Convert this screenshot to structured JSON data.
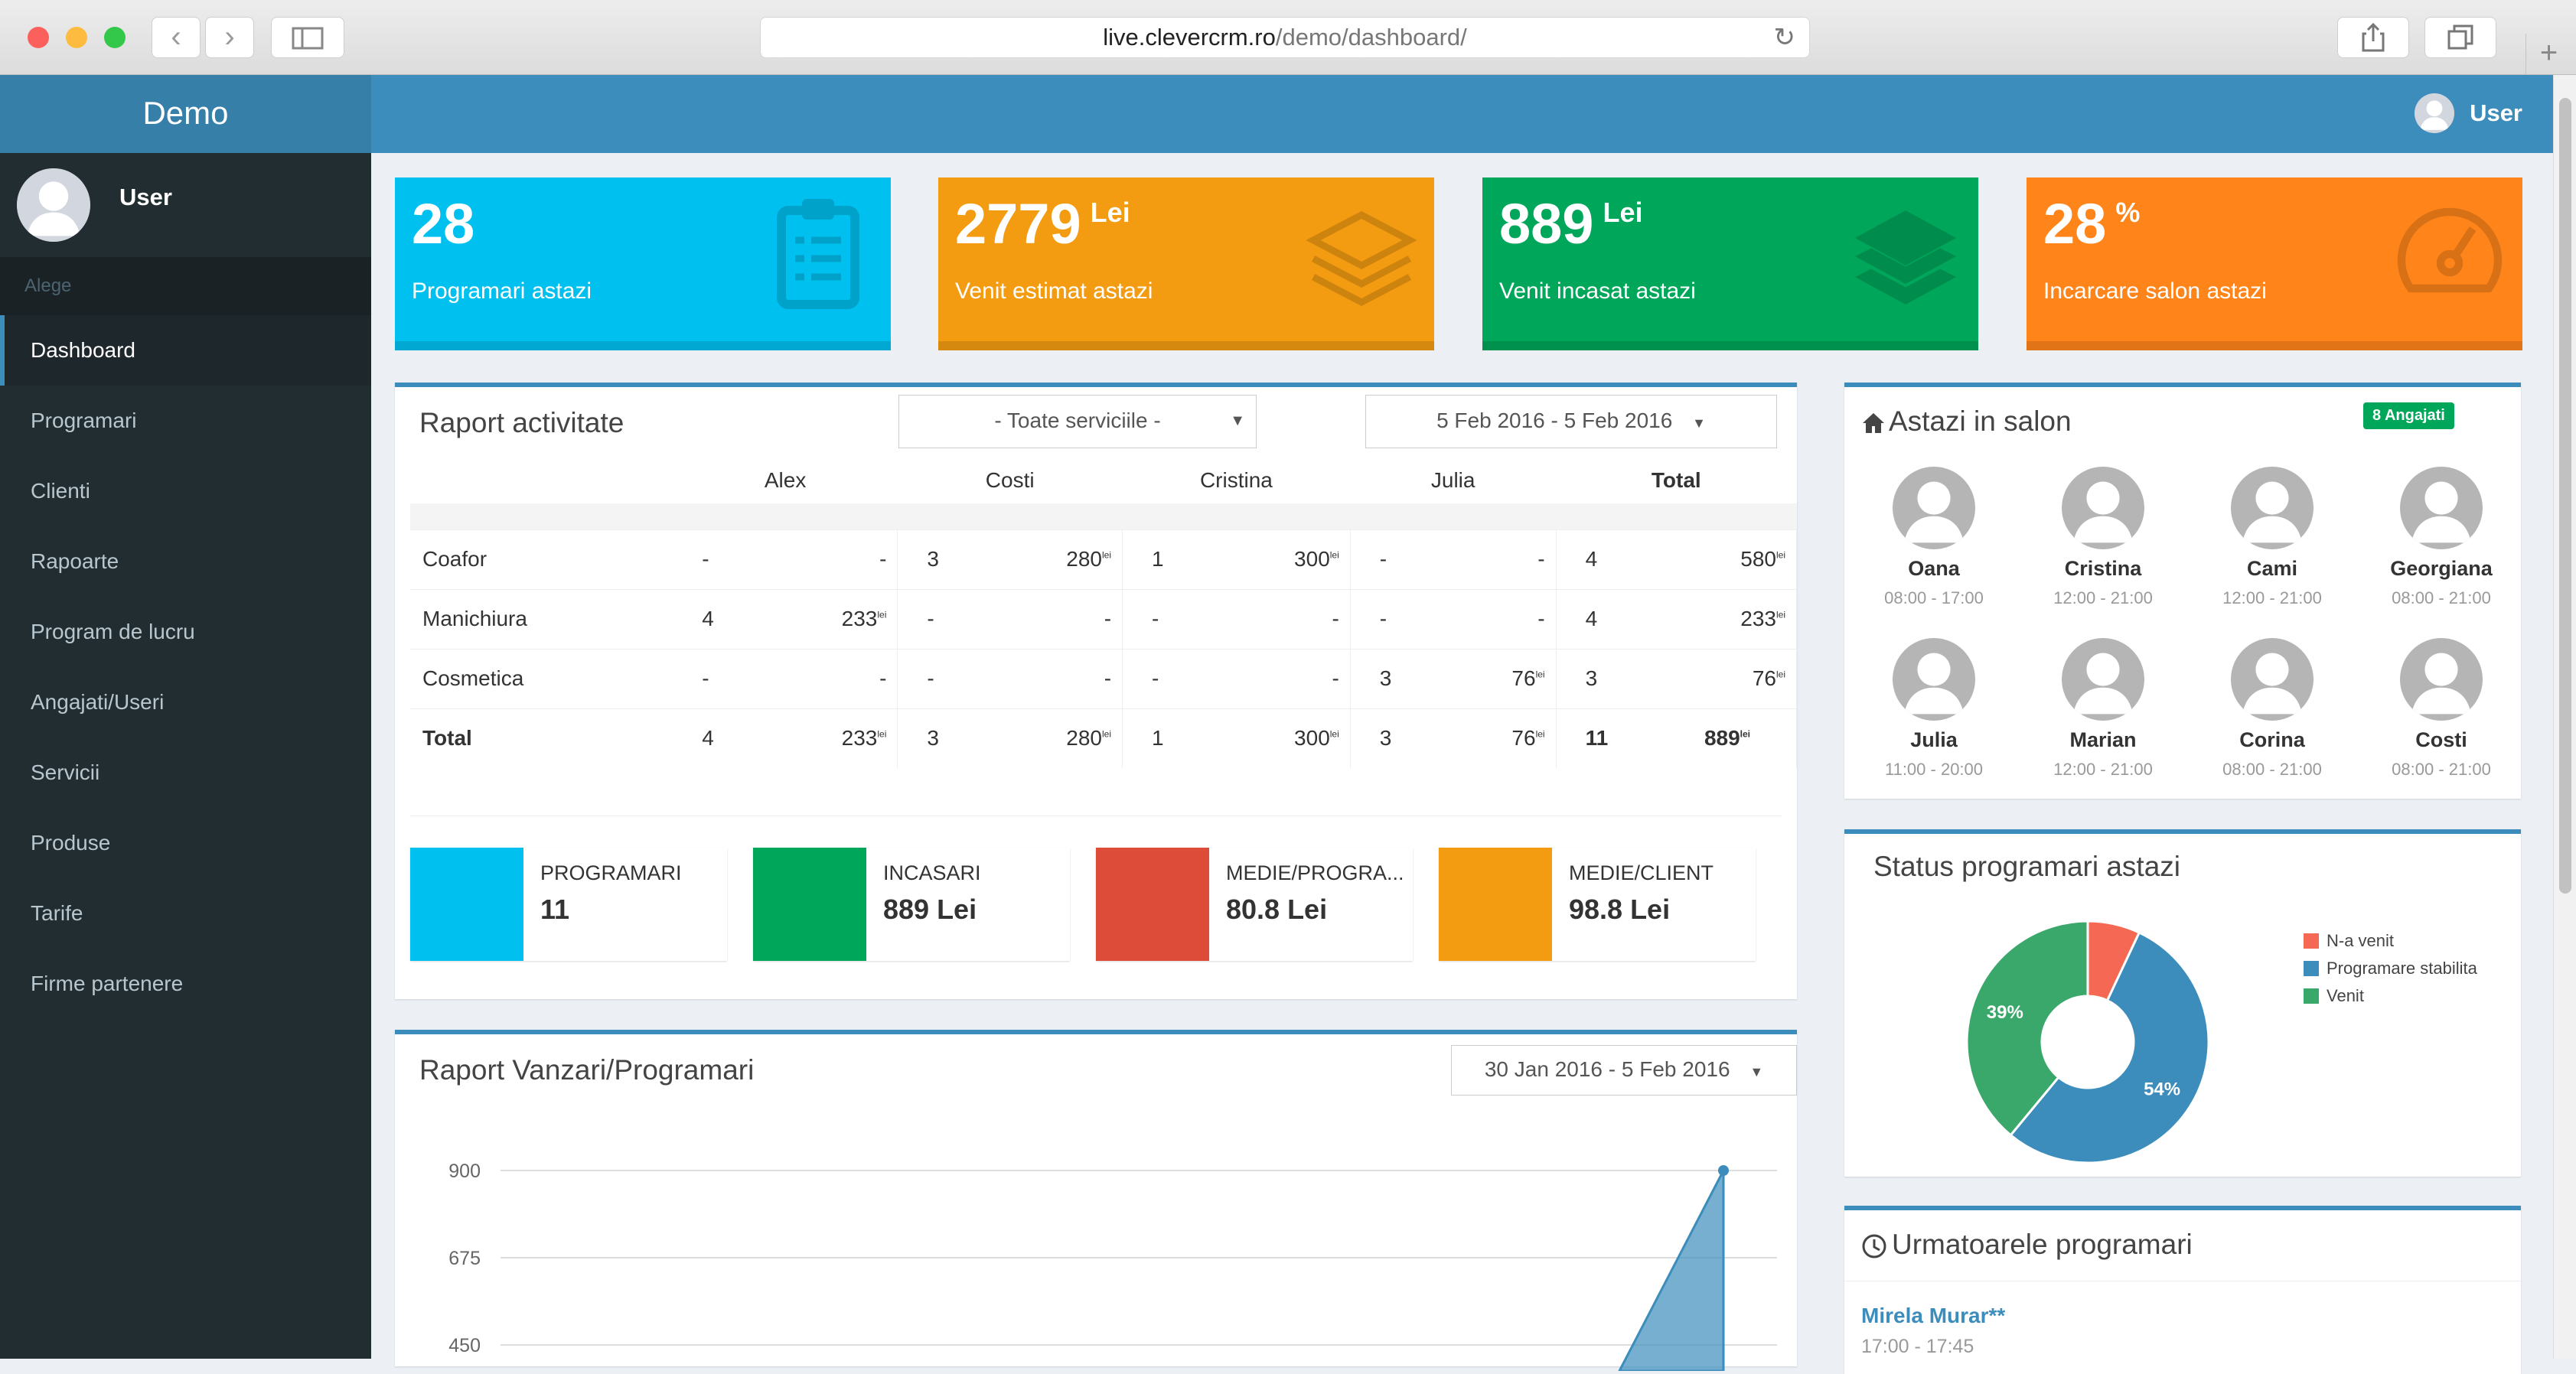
{
  "browser": {
    "url_host": "live.clevercrm.ro",
    "url_path": "/demo/dashboard/"
  },
  "sidebar": {
    "brand": "Demo",
    "user": "User",
    "section": "Alege",
    "items": [
      {
        "label": "Dashboard",
        "active": true
      },
      {
        "label": "Programari"
      },
      {
        "label": "Clienti"
      },
      {
        "label": "Rapoarte"
      },
      {
        "label": "Program de lucru"
      },
      {
        "label": "Angajati/Useri"
      },
      {
        "label": "Servicii"
      },
      {
        "label": "Produse"
      },
      {
        "label": "Tarife"
      },
      {
        "label": "Firme partenere"
      }
    ]
  },
  "topbar": {
    "user": "User"
  },
  "stats": [
    {
      "value": "28",
      "unit": "",
      "label": "Programari astazi",
      "color": "#00c0ef",
      "icon": "clipboard-icon"
    },
    {
      "value": "2779",
      "unit": "Lei",
      "label": "Venit estimat astazi",
      "color": "#f39c12",
      "icon": "layers-outline-icon"
    },
    {
      "value": "889",
      "unit": "Lei",
      "label": "Venit incasat astazi",
      "color": "#00a65a",
      "icon": "layers-filled-icon"
    },
    {
      "value": "28",
      "unit": "%",
      "label": "Incarcare salon astazi",
      "color": "#ff851b",
      "icon": "speedometer-icon"
    }
  ],
  "raport": {
    "title": "Raport activitate",
    "service_select": "- Toate serviciile -",
    "date_range": "5 Feb 2016 - 5 Feb 2016",
    "columns": [
      "Alex",
      "Costi",
      "Cristina",
      "Julia",
      "Total"
    ],
    "currency_sup": "lei",
    "rows": [
      {
        "name": "Coafor",
        "cells": [
          [
            "-",
            "-"
          ],
          [
            "3",
            "280"
          ],
          [
            "1",
            "300"
          ],
          [
            "-",
            "-"
          ],
          [
            "4",
            "580"
          ]
        ]
      },
      {
        "name": "Manichiura",
        "cells": [
          [
            "4",
            "233"
          ],
          [
            "-",
            "-"
          ],
          [
            "-",
            "-"
          ],
          [
            "-",
            "-"
          ],
          [
            "4",
            "233"
          ]
        ]
      },
      {
        "name": "Cosmetica",
        "cells": [
          [
            "-",
            "-"
          ],
          [
            "-",
            "-"
          ],
          [
            "-",
            "-"
          ],
          [
            "3",
            "76"
          ],
          [
            "3",
            "76"
          ]
        ]
      },
      {
        "name": "Total",
        "cells": [
          [
            "4",
            "233"
          ],
          [
            "3",
            "280"
          ],
          [
            "1",
            "300"
          ],
          [
            "3",
            "76"
          ],
          [
            "11",
            "889"
          ]
        ]
      }
    ],
    "info_boxes": [
      {
        "title": "PROGRAMARI",
        "value": "11",
        "color": "#00c0ef"
      },
      {
        "title": "INCASARI",
        "value": "889 Lei",
        "color": "#00a65a"
      },
      {
        "title": "MEDIE/PROGRA...",
        "value": "80.8 Lei",
        "color": "#dd4b39"
      },
      {
        "title": "MEDIE/CLIENT",
        "value": "98.8 Lei",
        "color": "#f39c12"
      }
    ]
  },
  "vanzari": {
    "title": "Raport Vanzari/Programari",
    "date_range": "30 Jan 2016 - 5 Feb 2016"
  },
  "chart_data": [
    {
      "type": "area",
      "title": "Raport Vanzari/Programari",
      "yticks": [
        900,
        675,
        450
      ],
      "points_visible": [
        {
          "x": "last",
          "y": 900
        }
      ],
      "color": "#3c8dbc"
    },
    {
      "type": "pie",
      "title": "Status programari astazi",
      "labels": [
        "N-a venit",
        "Programare stabilita",
        "Venit"
      ],
      "values": [
        7,
        54,
        39
      ],
      "data_labels": [
        "",
        "54%",
        "39%"
      ],
      "colors": [
        "#f56954",
        "#3c8dbc",
        "#3aa86a"
      ],
      "legend": "right"
    }
  ],
  "salon": {
    "title": "Astazi in salon",
    "badge": "8 Angajati",
    "employees": [
      {
        "name": "Oana",
        "hours": "08:00 - 17:00"
      },
      {
        "name": "Cristina",
        "hours": "12:00 - 21:00"
      },
      {
        "name": "Cami",
        "hours": "12:00 - 21:00"
      },
      {
        "name": "Georgiana",
        "hours": "08:00 - 21:00"
      },
      {
        "name": "Julia",
        "hours": "11:00 - 20:00"
      },
      {
        "name": "Marian",
        "hours": "12:00 - 21:00"
      },
      {
        "name": "Corina",
        "hours": "08:00 - 21:00"
      },
      {
        "name": "Costi",
        "hours": "08:00 - 21:00"
      }
    ]
  },
  "status": {
    "title": "Status programari astazi"
  },
  "urmatoarele": {
    "title": "Urmatoarele programari",
    "items": [
      {
        "client": "Mirela Murar**",
        "time": "17:00 - 17:45"
      }
    ]
  }
}
